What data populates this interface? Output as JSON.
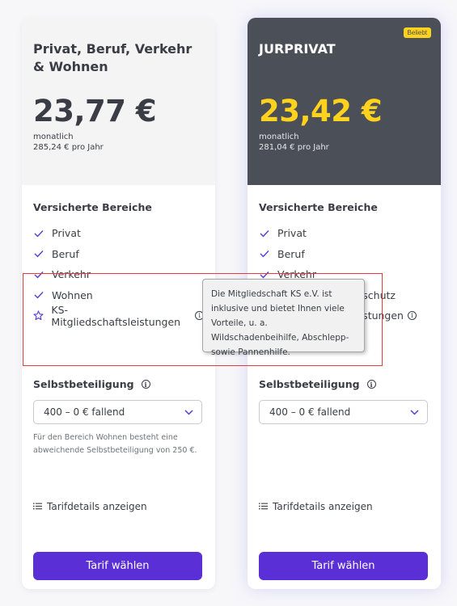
{
  "plans": [
    {
      "title": "Privat, Beruf, Verkehr & Wohnen",
      "badge": "",
      "price": "23,77 €",
      "period": "monatlich",
      "yearly": "285,24 € pro Jahr",
      "section_title": "Versicherte Bereiche",
      "features": [
        {
          "label": "Privat",
          "icon": "check-icon"
        },
        {
          "label": "Beruf",
          "icon": "check-icon"
        },
        {
          "label": "Verkehr",
          "icon": "check-icon"
        },
        {
          "label": "Wohnen",
          "icon": "check-icon"
        },
        {
          "label": "KS-Mitgliedschaftsleistungen",
          "icon": "star-icon"
        }
      ],
      "deductible_label": "Selbstbeteiligung",
      "deductible_value": "400 – 0 € fallend",
      "note": "Für den Bereich Wohnen besteht eine abweichende Selbstbeteiligung von 250 €.",
      "details_label": "Tarifdetails anzeigen",
      "cta_label": "Tarif wählen"
    },
    {
      "title": "JURPRIVAT",
      "badge": "Beliebt",
      "price": "23,42 €",
      "period": "monatlich",
      "yearly": "281,04 € pro Jahr",
      "section_title": "Versicherte Bereiche",
      "features": [
        {
          "label": "Privat",
          "icon": "check-icon"
        },
        {
          "label": "Beruf",
          "icon": "check-icon"
        },
        {
          "label": "Verkehr",
          "icon": "check-icon"
        },
        {
          "label": "schutz",
          "icon": "check-icon"
        },
        {
          "label": "eistungen",
          "icon": "star-icon"
        }
      ],
      "deductible_label": "Selbstbeteiligung",
      "deductible_value": "400 – 0 € fallend",
      "note": "",
      "details_label": "Tarifdetails anzeigen",
      "cta_label": "Tarif wählen"
    }
  ],
  "tooltip": {
    "text": "Die Mitgliedschaft KS e.V. ist inklusive und bietet Ihnen viele Vorteile, u. a. Wildschadenbeihilfe, Abschlepp- sowie Pannenhilfe."
  },
  "colors": {
    "accent": "#5b2fd6",
    "highlight_price": "#ffd21e",
    "dark_header": "#4b4f58",
    "highlight_box": "#e53b3b"
  }
}
